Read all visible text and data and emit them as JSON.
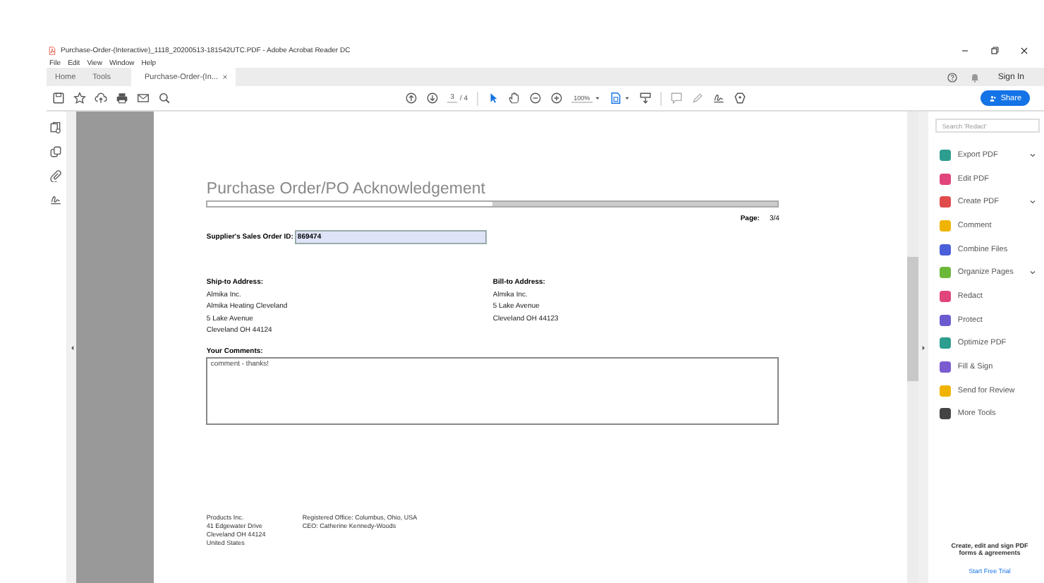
{
  "window": {
    "title": "Purchase-Order-(Interactive)_1118_20200513-181542UTC.PDF - Adobe Acrobat Reader DC"
  },
  "menu": [
    "File",
    "Edit",
    "View",
    "Window",
    "Help"
  ],
  "tabs": [
    {
      "label": "Home",
      "selected": false,
      "closable": false
    },
    {
      "label": "Tools",
      "selected": false,
      "closable": false
    },
    {
      "label": "Purchase-Order-(In...",
      "selected": true,
      "closable": true
    }
  ],
  "header_actions": {
    "sign_in": "Sign In"
  },
  "toolbar": {
    "page_current": "3",
    "page_total": "/ 4",
    "zoom": "100%",
    "share": "Share"
  },
  "document": {
    "title": "Purchase Order/PO Acknowledgement",
    "progress": {
      "level": 0.5
    },
    "page_label": "Page:",
    "page_value": "3/4",
    "order_id_label": "Supplier's Sales Order ID:",
    "order_id_value": "869474",
    "ship_to": {
      "heading": "Ship-to Address:",
      "lines": [
        "Almika Inc.",
        "Almika Heating Cleveland",
        "5 Lake Avenue",
        "Cleveland OH  44124"
      ]
    },
    "bill_to": {
      "heading": "Bill-to Address:",
      "lines": [
        "Almika Inc.",
        "5 Lake Avenue",
        "Cleveland OH  44123"
      ]
    },
    "comments_label": "Your Comments:",
    "comments_value": "comment - thanks!",
    "footer_left": [
      "Products Inc.",
      "41 Edgewater Drive",
      "Cleveland OH 44124",
      "United States"
    ],
    "footer_right": [
      "Registered Office: Columbus, Ohio, USA",
      "CEO: Catherine Kennedy-Woods"
    ]
  },
  "tools_panel": {
    "search_placeholder": "Search 'Redact'",
    "items": [
      {
        "label": "Export PDF",
        "color": "#2d9d8f",
        "expandable": true
      },
      {
        "label": "Edit PDF",
        "color": "#e0457b",
        "expandable": false
      },
      {
        "label": "Create PDF",
        "color": "#e04b4b",
        "expandable": true
      },
      {
        "label": "Comment",
        "color": "#f0b400",
        "expandable": false
      },
      {
        "label": "Combine Files",
        "color": "#4a5fd8",
        "expandable": false
      },
      {
        "label": "Organize Pages",
        "color": "#6bb83a",
        "expandable": true
      },
      {
        "label": "Redact",
        "color": "#e0457b",
        "expandable": false
      },
      {
        "label": "Protect",
        "color": "#6b5bd0",
        "expandable": false
      },
      {
        "label": "Optimize PDF",
        "color": "#2d9d8f",
        "expandable": false
      },
      {
        "label": "Fill & Sign",
        "color": "#7b5bd0",
        "expandable": false
      },
      {
        "label": "Send for Review",
        "color": "#f0b400",
        "expandable": false
      },
      {
        "label": "More Tools",
        "color": "#444444",
        "expandable": false
      }
    ],
    "promo_text": "Create, edit and sign PDF forms & agreements",
    "promo_link": "Start Free Trial"
  }
}
